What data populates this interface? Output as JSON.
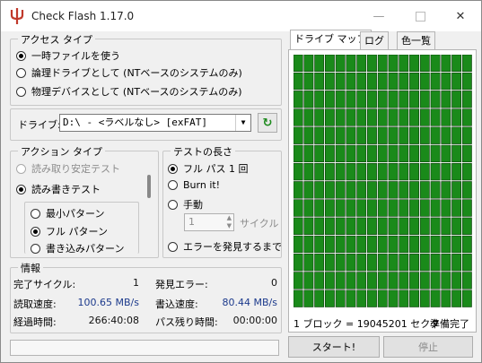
{
  "window": {
    "title": "Check Flash 1.17.0"
  },
  "access": {
    "legend": "アクセス タイプ",
    "options": [
      "一時ファイルを使う",
      "論理ドライブとして (NTベースのシステムのみ)",
      "物理デバイスとして (NTベースのシステムのみ)"
    ],
    "selected_index": 0
  },
  "drive": {
    "label": "ドライブ:",
    "value": "D:\\ - <ラベルなし> [exFAT]"
  },
  "action": {
    "legend": "アクション タイプ",
    "options": [
      "読み取り安定テスト",
      "読み書きテスト"
    ],
    "selected_index": 1,
    "sub_options": [
      "最小パターン",
      "フル パターン",
      "書き込みパターン"
    ],
    "sub_selected_index": 1
  },
  "length": {
    "legend": "テストの長さ",
    "options": [
      "フル パス 1 回",
      "Burn it!",
      "手動"
    ],
    "selected_index": 0,
    "cycles_value": "1",
    "cycles_label": "サイクル",
    "until_error": "エラーを発見するまで"
  },
  "info": {
    "legend": "情報",
    "completed_cycles_label": "完了サイクル:",
    "completed_cycles_value": "1",
    "errors_label": "発見エラー:",
    "errors_value": "0",
    "read_speed_label": "読取速度:",
    "read_speed_value": "100.65 MB/s",
    "write_speed_label": "書込速度:",
    "write_speed_value": "80.44 MB/s",
    "elapsed_label": "経過時間:",
    "elapsed_value": "266:40:08",
    "remaining_label": "パス残り時間:",
    "remaining_value": "00:00:00"
  },
  "tabs": [
    "ドライブ マップ",
    "ログ",
    "色一覧"
  ],
  "map": {
    "block_info": "1 ブロック = 19045201 セクタ",
    "status": "準備完了",
    "rows": 14,
    "cols": 17,
    "block_color": "#1a8a1a"
  },
  "buttons": {
    "start": "スタート!",
    "stop": "停止"
  }
}
